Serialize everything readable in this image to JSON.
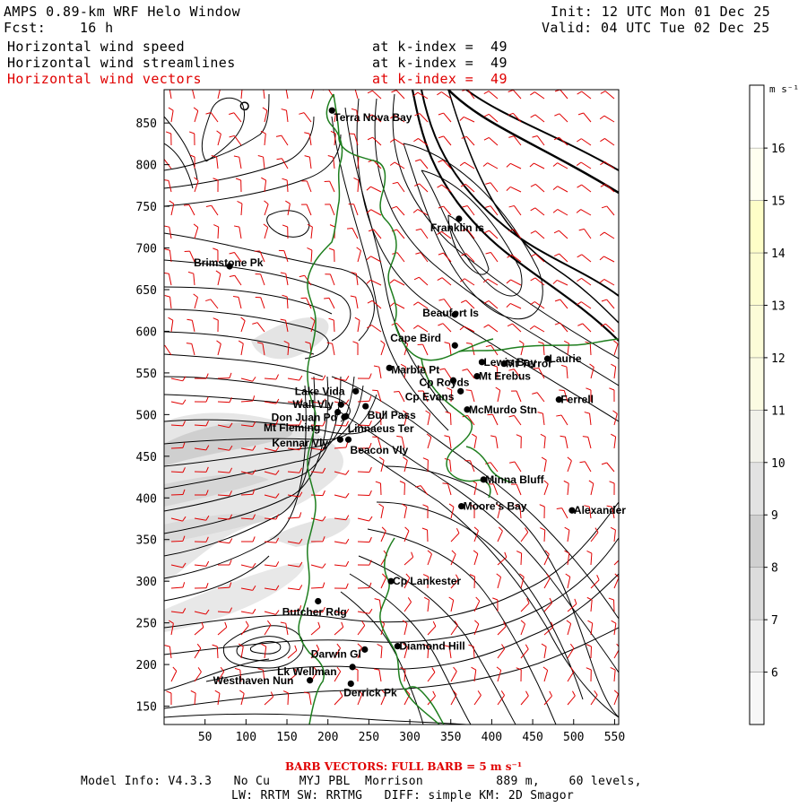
{
  "header": {
    "title": "AMPS 0.89-km WRF Helo Window",
    "fcst": "Fcst:    16 h",
    "init": "Init: 12 UTC Mon 01 Dec 25",
    "valid": "Valid: 04 UTC Tue 02 Dec 25",
    "fields": [
      {
        "name": "Horizontal wind speed",
        "level": "at k-index =  49",
        "color": "#000000"
      },
      {
        "name": "Horizontal wind streamlines",
        "level": "at k-index =  49",
        "color": "#000000"
      },
      {
        "name": "Horizontal wind vectors",
        "level": "at k-index =  49",
        "color": "#e00000"
      }
    ]
  },
  "axes": {
    "x_ticks": [
      50,
      100,
      150,
      200,
      250,
      300,
      350,
      400,
      450,
      500,
      550
    ],
    "y_ticks": [
      150,
      200,
      250,
      300,
      350,
      400,
      450,
      500,
      550,
      600,
      650,
      700,
      750,
      800,
      850
    ],
    "x_range": [
      0,
      555
    ],
    "y_range": [
      128,
      890
    ]
  },
  "colorbar": {
    "unit": "m s⁻¹",
    "labels": [
      "6",
      "7",
      "8",
      "9",
      "10",
      "11",
      "12",
      "13",
      "14",
      "15",
      "16"
    ],
    "colors": [
      "#f7f7f7",
      "#ececec",
      "#dcdcdc",
      "#d0d0d0",
      "#e2e2e2",
      "#f2f2ea",
      "#fbfbe2",
      "#fcfcd8",
      "#fdfdd0",
      "#fefec8",
      "#fffff0"
    ]
  },
  "locations": [
    {
      "name": "Terra Nova Bay",
      "x": 205,
      "y": 865
    },
    {
      "name": "Franklin Is",
      "x": 360,
      "y": 735
    },
    {
      "name": "Brimstone Pk",
      "x": 80,
      "y": 678
    },
    {
      "name": "Beaufort Is",
      "x": 355,
      "y": 620
    },
    {
      "name": "Cape Bird",
      "x": 355,
      "y": 583
    },
    {
      "name": "Lewis Bay",
      "x": 388,
      "y": 563
    },
    {
      "name": "Mt Terror",
      "x": 415,
      "y": 561
    },
    {
      "name": "Laurie",
      "x": 468,
      "y": 567
    },
    {
      "name": "Marble Pt",
      "x": 275,
      "y": 556
    },
    {
      "name": "Cp Royds",
      "x": 353,
      "y": 541
    },
    {
      "name": "Mt Erebus",
      "x": 382,
      "y": 546
    },
    {
      "name": "Lake Vida",
      "x": 234,
      "y": 528
    },
    {
      "name": "Cp Evans",
      "x": 362,
      "y": 528
    },
    {
      "name": "Ferrell",
      "x": 482,
      "y": 518
    },
    {
      "name": "Wall Vly",
      "x": 216,
      "y": 512
    },
    {
      "name": "Bull Pass",
      "x": 246,
      "y": 510
    },
    {
      "name": "McMurdo Stn",
      "x": 370,
      "y": 506
    },
    {
      "name": "Don Juan Pd",
      "x": 212,
      "y": 503
    },
    {
      "name": "Mt Fleming",
      "x": 220,
      "y": 497
    },
    {
      "name": "Linnaeus Ter",
      "x": 222,
      "y": 498
    },
    {
      "name": "Kennar Vly",
      "x": 215,
      "y": 470
    },
    {
      "name": "Beacon Vly",
      "x": 225,
      "y": 470
    },
    {
      "name": "Minna Bluff",
      "x": 390,
      "y": 422
    },
    {
      "name": "Moore's Bay",
      "x": 363,
      "y": 390
    },
    {
      "name": "Alexander",
      "x": 498,
      "y": 385
    },
    {
      "name": "Cp Lankester",
      "x": 277,
      "y": 300
    },
    {
      "name": "Butcher Rdg",
      "x": 188,
      "y": 276
    },
    {
      "name": "Diamond Hill",
      "x": 285,
      "y": 222
    },
    {
      "name": "Darwin Gl",
      "x": 245,
      "y": 218
    },
    {
      "name": "Lk Wellman",
      "x": 230,
      "y": 197
    },
    {
      "name": "Westhaven Nun",
      "x": 178,
      "y": 181
    },
    {
      "name": "Derrick Pk",
      "x": 228,
      "y": 177
    }
  ],
  "footer": {
    "barb_note": "BARB VECTORS:  FULL BARB = 5 m s⁻¹",
    "model_info": "Model Info: V4.3.3   No Cu    MYJ PBL  Morrison          889 m,    60 levels,",
    "physics": "LW: RRTM SW: RRTMG   DIFF: simple KM: 2D Smagor"
  },
  "colors": {
    "coast": "#1e7e1e",
    "barbs": "#e00000",
    "streamlines": "#000000"
  }
}
